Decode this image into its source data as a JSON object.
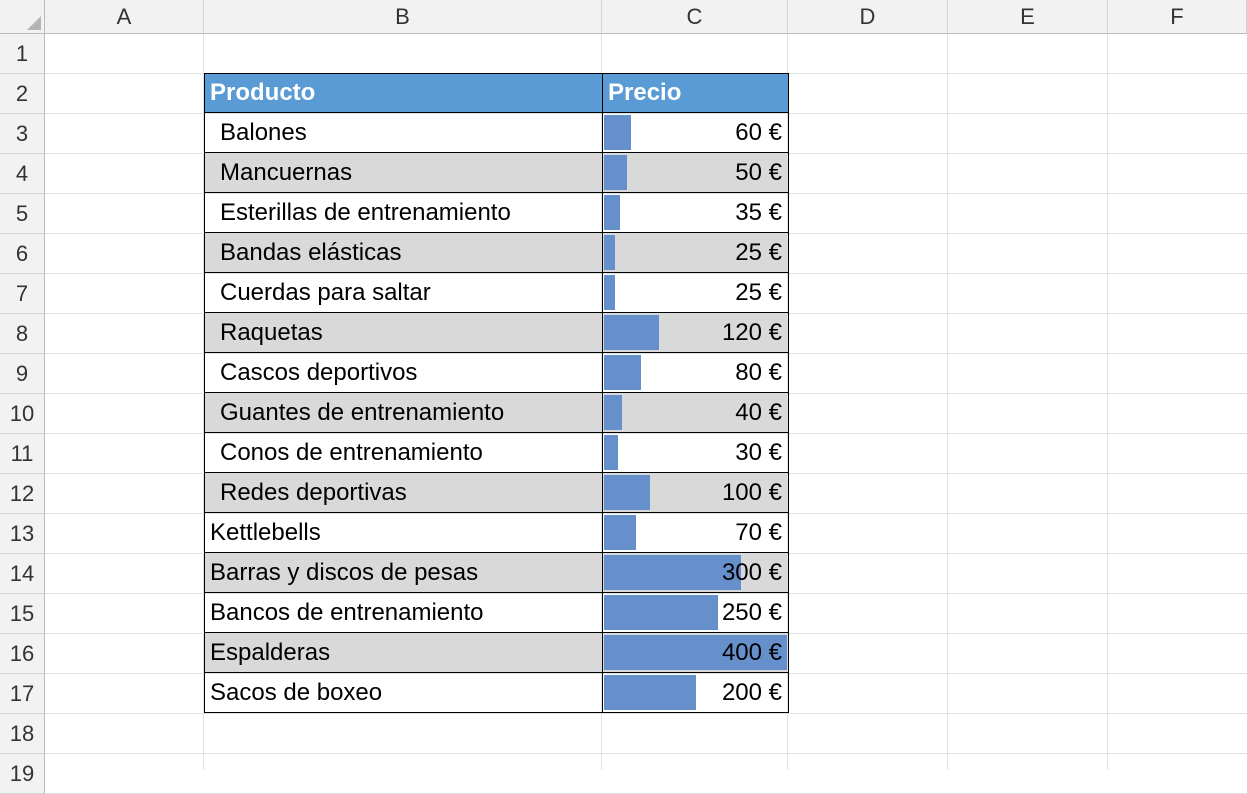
{
  "columns": [
    "A",
    "B",
    "C",
    "D",
    "E",
    "F"
  ],
  "rows": [
    "1",
    "2",
    "3",
    "4",
    "5",
    "6",
    "7",
    "8",
    "9",
    "10",
    "11",
    "12",
    "13",
    "14",
    "15",
    "16",
    "17",
    "18",
    "19"
  ],
  "table": {
    "header": {
      "product": "Producto",
      "price": "Precio"
    },
    "max_price": 400,
    "bar_color": "#6690cc",
    "header_color": "#5b9bd5",
    "shade_color": "#d9d9d9",
    "items": [
      {
        "product": "Balones",
        "price": 60,
        "price_label": "60 €",
        "indent": true
      },
      {
        "product": "Mancuernas",
        "price": 50,
        "price_label": "50 €",
        "indent": true
      },
      {
        "product": "Esterillas de entrenamiento",
        "price": 35,
        "price_label": "35 €",
        "indent": true
      },
      {
        "product": "Bandas elásticas",
        "price": 25,
        "price_label": "25 €",
        "indent": true
      },
      {
        "product": "Cuerdas para saltar",
        "price": 25,
        "price_label": "25 €",
        "indent": true
      },
      {
        "product": "Raquetas",
        "price": 120,
        "price_label": "120 €",
        "indent": true
      },
      {
        "product": "Cascos deportivos",
        "price": 80,
        "price_label": "80 €",
        "indent": true
      },
      {
        "product": "Guantes de entrenamiento",
        "price": 40,
        "price_label": "40 €",
        "indent": true
      },
      {
        "product": "Conos de entrenamiento",
        "price": 30,
        "price_label": "30 €",
        "indent": true
      },
      {
        "product": "Redes deportivas",
        "price": 100,
        "price_label": "100 €",
        "indent": true
      },
      {
        "product": "Kettlebells",
        "price": 70,
        "price_label": "70 €",
        "indent": false
      },
      {
        "product": "Barras y discos de pesas",
        "price": 300,
        "price_label": "300 €",
        "indent": false
      },
      {
        "product": "Bancos de entrenamiento",
        "price": 250,
        "price_label": "250 €",
        "indent": false
      },
      {
        "product": "Espalderas",
        "price": 400,
        "price_label": "400 €",
        "indent": false
      },
      {
        "product": "Sacos de boxeo",
        "price": 200,
        "price_label": "200 €",
        "indent": false
      }
    ]
  }
}
